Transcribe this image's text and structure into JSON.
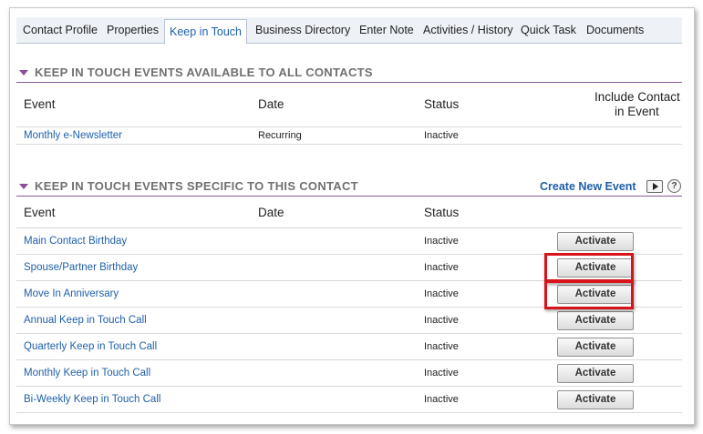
{
  "tabs": [
    {
      "label": "Contact Profile"
    },
    {
      "label": "Properties"
    },
    {
      "label": "Keep in Touch"
    },
    {
      "label": "Business Directory"
    },
    {
      "label": "Enter Note"
    },
    {
      "label": "Activities / History"
    },
    {
      "label": "Quick Task"
    },
    {
      "label": "Documents"
    }
  ],
  "active_tab": "Keep in Touch",
  "section_all": {
    "title": "KEEP IN TOUCH EVENTS AVAILABLE TO ALL CONTACTS",
    "columns": {
      "event": "Event",
      "date": "Date",
      "status": "Status",
      "include_line1": "Include Contact",
      "include_line2": "in Event"
    },
    "rows": [
      {
        "event": "Monthly e-Newsletter",
        "date": "Recurring",
        "status": "Inactive"
      }
    ]
  },
  "section_specific": {
    "title": "KEEP IN TOUCH EVENTS SPECIFIC TO THIS CONTACT",
    "create_link": "Create New Event",
    "help_icon_text": "?",
    "columns": {
      "event": "Event",
      "date": "Date",
      "status": "Status"
    },
    "rows": [
      {
        "event": "Main Contact Birthday",
        "date": "",
        "status": "Inactive",
        "action": "Activate",
        "highlighted": false
      },
      {
        "event": "Spouse/Partner Birthday",
        "date": "",
        "status": "Inactive",
        "action": "Activate",
        "highlighted": true
      },
      {
        "event": "Move In Anniversary",
        "date": "",
        "status": "Inactive",
        "action": "Activate",
        "highlighted": true
      },
      {
        "event": "Annual Keep in Touch Call",
        "date": "",
        "status": "Inactive",
        "action": "Activate",
        "highlighted": false
      },
      {
        "event": "Quarterly Keep in Touch Call",
        "date": "",
        "status": "Inactive",
        "action": "Activate",
        "highlighted": false
      },
      {
        "event": "Monthly Keep in Touch Call",
        "date": "",
        "status": "Inactive",
        "action": "Activate",
        "highlighted": false
      },
      {
        "event": "Bi-Weekly Keep in Touch Call",
        "date": "",
        "status": "Inactive",
        "action": "Activate",
        "highlighted": false
      }
    ]
  },
  "colors": {
    "link": "#1f5fa8",
    "section_accent": "#8a4d9a",
    "highlight": "#d8141a"
  }
}
